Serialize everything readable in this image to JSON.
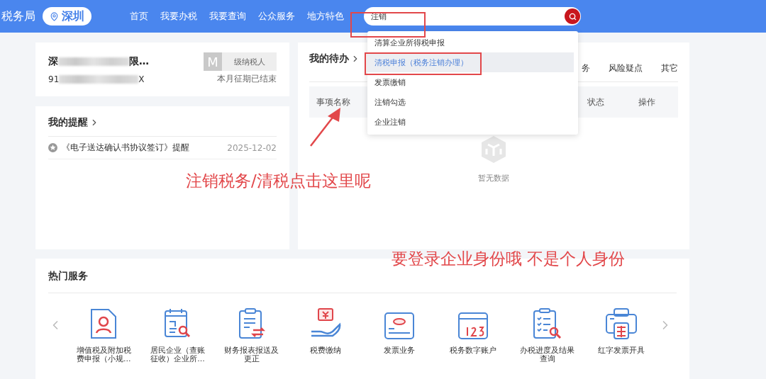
{
  "header": {
    "brand": "税务局",
    "city": "深圳",
    "nav": [
      {
        "label": "首页"
      },
      {
        "label": "我要办税"
      },
      {
        "label": "我要查询"
      },
      {
        "label": "公众服务"
      },
      {
        "label": "地方特色"
      }
    ],
    "search": {
      "value": "注销"
    },
    "suggestions": [
      {
        "label": "清算企业所得税申报",
        "selected": false
      },
      {
        "label": "清税申报（税务注销办理）",
        "selected": true
      },
      {
        "label": "发票缴销",
        "selected": false
      },
      {
        "label": "注销勾选",
        "selected": false
      },
      {
        "label": "企业注销",
        "selected": false
      }
    ]
  },
  "taxpayer": {
    "name_start": "深",
    "name_end": "限…",
    "badge_letter": "M",
    "badge_label": "级纳税人",
    "id_start": "91",
    "id_end": "X",
    "period_status": "本月征期已结束"
  },
  "reminders": {
    "title": "我的提醒",
    "items": [
      {
        "text": "《电子送达确认书协议签订》提醒",
        "date": "2025-12-02"
      }
    ]
  },
  "todo": {
    "title": "我的待办",
    "tabs": [
      {
        "label": "务"
      },
      {
        "label": "风险疑点"
      },
      {
        "label": "其它"
      }
    ],
    "columns": [
      "事项名称",
      "状态",
      "操作"
    ],
    "empty": "暂无数据"
  },
  "hot_services": {
    "title": "热门服务",
    "items": [
      {
        "label": "增值税及附加税费申报（小规…"
      },
      {
        "label": "居民企业（查账征收）企业所…"
      },
      {
        "label": "财务报表报送及更正"
      },
      {
        "label": "税费缴纳"
      },
      {
        "label": "发票业务"
      },
      {
        "label": "税务数字账户"
      },
      {
        "label": "办税进度及结果查询"
      },
      {
        "label": "红字发票开具"
      }
    ]
  },
  "annotations": [
    {
      "text": "注销税务/清税点击这里呢"
    },
    {
      "text": "要登录企业身份哦 不是个人身份"
    }
  ]
}
